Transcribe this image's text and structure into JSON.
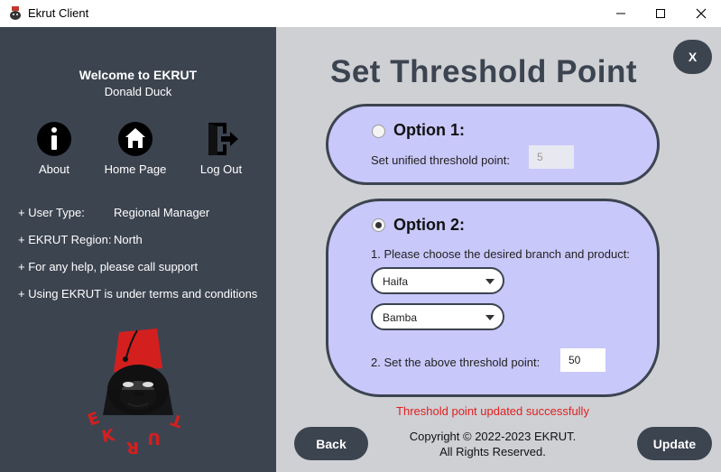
{
  "window": {
    "title": "Ekrut Client"
  },
  "sidebar": {
    "welcome": "Welcome to EKRUT",
    "username": "Donald Duck",
    "nav": [
      {
        "label": "About",
        "icon": "info-icon"
      },
      {
        "label": "Home Page",
        "icon": "home-icon"
      },
      {
        "label": "Log Out",
        "icon": "logout-icon"
      }
    ],
    "info": {
      "user_type_label": "+ User Type:",
      "user_type_value": "Regional Manager",
      "region_label": "+ EKRUT Region:",
      "region_value": "North",
      "help_text": "+ For any help, please call support",
      "terms_text": "+ Using EKRUT is under terms and conditions"
    },
    "logo_icon": "ekrut-gorilla-logo"
  },
  "main": {
    "close_label": "X",
    "title": "Set Threshold Point",
    "option1": {
      "title": "Option 1:",
      "selected": false,
      "field_label": "Set unified threshold point:",
      "field_value": "5"
    },
    "option2": {
      "title": "Option 2:",
      "selected": true,
      "choose_label": "1. Please choose the desired branch and product:",
      "branch_value": "Haifa",
      "product_value": "Bamba",
      "threshold_label": "2. Set the above threshold point:",
      "threshold_value": "50"
    },
    "status": "Threshold point updated successfully",
    "copyright_line1": "Copyright © 2022-2023 EKRUT.",
    "copyright_line2": "All Rights Reserved.",
    "back_label": "Back",
    "update_label": "Update"
  },
  "colors": {
    "sidebar_bg": "#3c4450",
    "main_bg": "#ced0d4",
    "card_bg": "#c9c8fb",
    "status_red": "#e02020",
    "logo_red": "#d41f1f"
  }
}
